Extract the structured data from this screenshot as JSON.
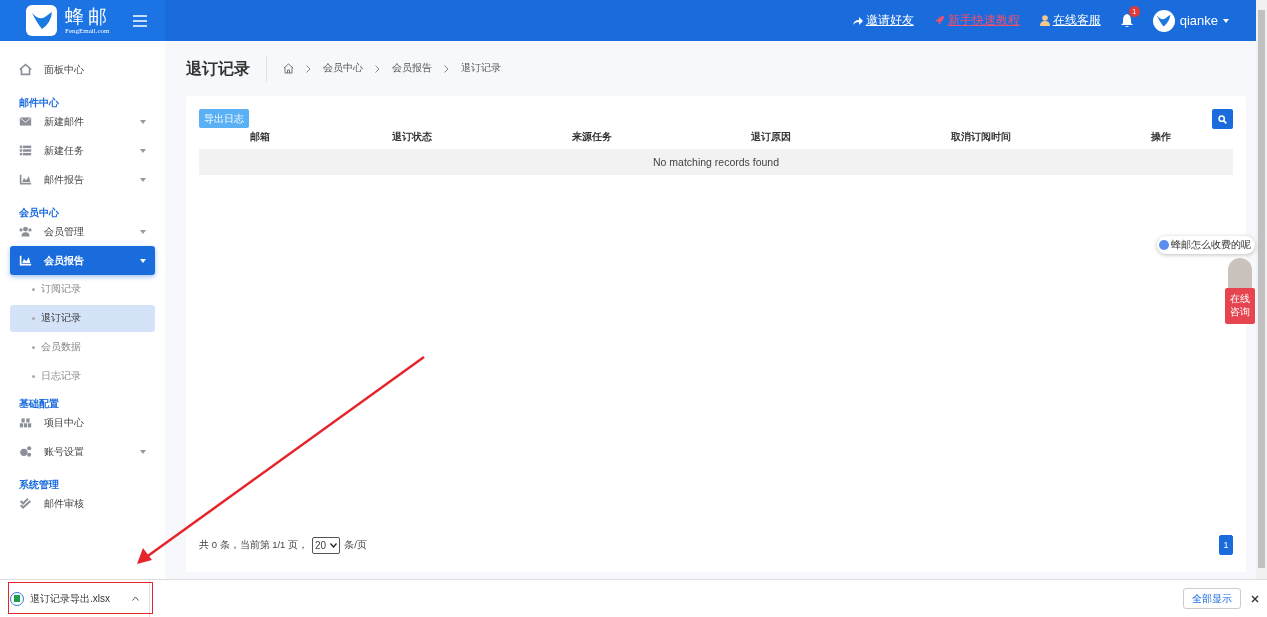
{
  "header": {
    "brand": "蜂邮",
    "brand_sub": "FengEmail.com",
    "links": [
      {
        "label": "邀请好友",
        "color": "#ffffff"
      },
      {
        "label": "新手快速教程",
        "color": "#f0506e"
      },
      {
        "label": "在线客服",
        "color": "#ffffff"
      }
    ],
    "notification_count": "1",
    "user": "qianke"
  },
  "sidebar": {
    "items": [
      {
        "kind": "item",
        "label": "面板中心",
        "dropdown": false,
        "selected": false
      },
      {
        "kind": "heading",
        "label": "邮件中心"
      },
      {
        "kind": "item",
        "label": "新建邮件",
        "dropdown": true,
        "selected": false
      },
      {
        "kind": "item",
        "label": "新建任务",
        "dropdown": true,
        "selected": false
      },
      {
        "kind": "item",
        "label": "邮件报告",
        "dropdown": true,
        "selected": false
      },
      {
        "kind": "heading",
        "label": "会员中心"
      },
      {
        "kind": "item",
        "label": "会员管理",
        "dropdown": true,
        "selected": false
      },
      {
        "kind": "item",
        "label": "会员报告",
        "dropdown": true,
        "selected": true,
        "children": [
          {
            "label": "订阅记录",
            "selected": false
          },
          {
            "label": "退订记录",
            "selected": true
          },
          {
            "label": "会员数据",
            "selected": false
          },
          {
            "label": "日志记录",
            "selected": false
          }
        ]
      },
      {
        "kind": "heading",
        "label": "基础配置"
      },
      {
        "kind": "item",
        "label": "项目中心",
        "dropdown": false,
        "selected": false
      },
      {
        "kind": "item",
        "label": "账号设置",
        "dropdown": true,
        "selected": false
      },
      {
        "kind": "heading",
        "label": "系统管理"
      },
      {
        "kind": "item",
        "label": "邮件审核",
        "dropdown": false,
        "selected": false
      }
    ]
  },
  "page": {
    "title": "退订记录",
    "breadcrumb": [
      "会员中心",
      "会员报告",
      "退订记录"
    ]
  },
  "table": {
    "export_button": "导出日志",
    "columns": [
      "邮箱",
      "退订状态",
      "来源任务",
      "退订原因",
      "取消订阅时间",
      "操作"
    ],
    "empty_message": "No matching records found",
    "footer": {
      "summary": "共 0 条，当前第 1/1 页，",
      "page_size": "20",
      "page_size_suffix": "条/页",
      "pages": [
        {
          "label": "1",
          "selected": true
        }
      ]
    }
  },
  "chat_widget": {
    "bubble": "蜂邮怎么收费的呢",
    "button": [
      "在线",
      "咨询"
    ]
  },
  "download_bar": {
    "file": "退订记录导出.xlsx",
    "show_all": "全部显示"
  }
}
